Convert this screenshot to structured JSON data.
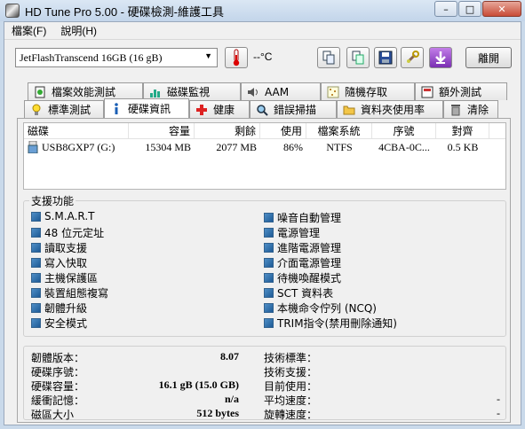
{
  "window": {
    "title": "HD Tune Pro  5.00 - 硬碟檢測-維護工具",
    "minimize": "–",
    "maximize": "□",
    "close": "✕"
  },
  "menu": {
    "file": "檔案(F)",
    "help": "說明(H)"
  },
  "toolbar": {
    "drive": "JetFlashTranscend 16GB   (16 gB)",
    "temperature": "--°C",
    "exit": "離開"
  },
  "tabs_top": [
    {
      "label": "檔案效能測試",
      "icon": "file-benchmark-icon"
    },
    {
      "label": "磁碟監視",
      "icon": "disk-monitor-icon"
    },
    {
      "label": "AAM",
      "icon": "speaker-icon"
    },
    {
      "label": "隨機存取",
      "icon": "random-access-icon"
    },
    {
      "label": "額外測試",
      "icon": "extra-tests-icon"
    }
  ],
  "tabs_bottom": [
    {
      "label": "標準測試",
      "icon": "benchmark-icon"
    },
    {
      "label": "硬碟資訊",
      "icon": "info-icon",
      "active": true
    },
    {
      "label": "健康",
      "icon": "health-cross-icon"
    },
    {
      "label": "錯誤掃描",
      "icon": "error-scan-icon"
    },
    {
      "label": "資料夾使用率",
      "icon": "folder-usage-icon"
    },
    {
      "label": "清除",
      "icon": "erase-icon"
    }
  ],
  "partitions": {
    "headers": [
      "磁碟",
      "容量",
      "剩餘",
      "使用",
      "檔案系統",
      "序號",
      "對齊"
    ],
    "rows": [
      {
        "disk": "USB8GXP7 (G:)",
        "capacity": "15304 MB",
        "free": "2077 MB",
        "used": "86%",
        "fs": "NTFS",
        "serial": "4CBA-0C...",
        "align": "0.5 KB"
      }
    ]
  },
  "features": {
    "title": "支援功能",
    "left": [
      "S.M.A.R.T",
      "48 位元定址",
      "讀取支援",
      "寫入快取",
      "主機保護區",
      "裝置組態複寫",
      "韌體升級",
      "安全模式"
    ],
    "right": [
      "噪音自動管理",
      "電源管理",
      "進階電源管理",
      "介面電源管理",
      "待機喚醒模式",
      "SCT 資料表",
      "本機命令佇列 (NCQ)",
      "TRIM指令(禁用刪除通知)"
    ]
  },
  "info": {
    "firmware_label": "韌體版本：",
    "firmware": "8.07",
    "serial_label": "硬碟序號：",
    "serial": "",
    "capacity_label": "硬碟容量：",
    "capacity": "16.1 gB (15.0 GB)",
    "buffer_label": "緩衝記憶：",
    "buffer": "n/a",
    "sector_label": "磁區大小",
    "sector": "512 bytes",
    "standard_label": "技術標準：",
    "standard": "",
    "support_label": "技術支援：",
    "support": "",
    "current_label": "目前使用：",
    "current": "",
    "avg_label": "平均速度：",
    "avg": "-",
    "rotation_label": "旋轉速度：",
    "rotation": "-"
  }
}
